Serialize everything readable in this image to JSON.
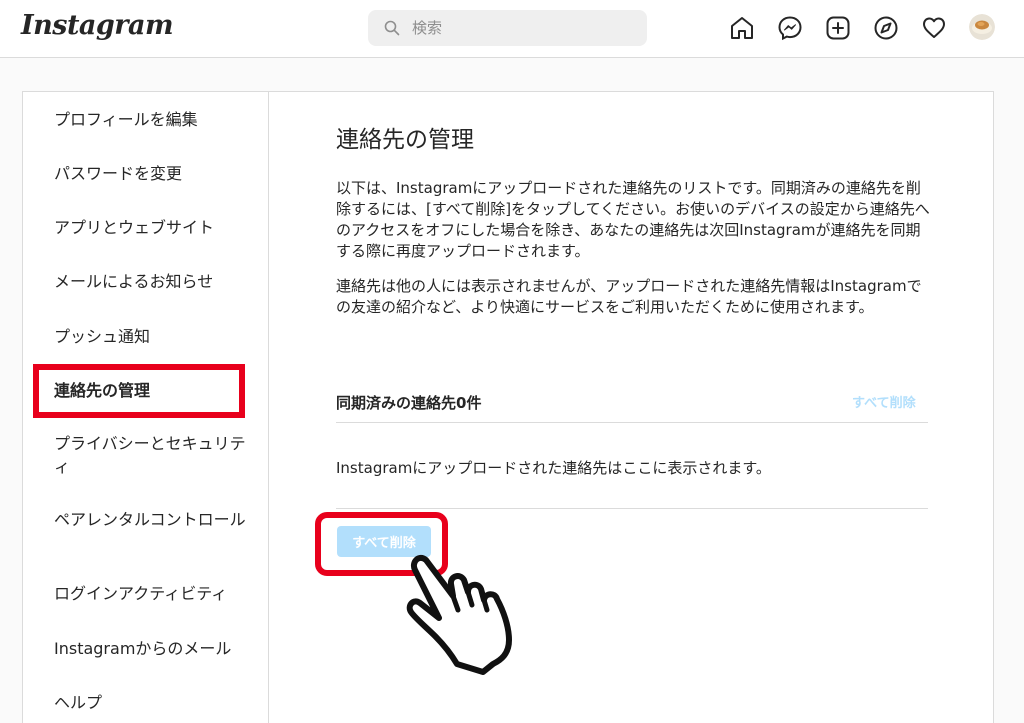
{
  "header": {
    "logo": "Instagram",
    "search_placeholder": "検索",
    "icons": [
      "home-icon",
      "messenger-icon",
      "new-post-icon",
      "explore-icon",
      "activity-heart-icon",
      "avatar"
    ]
  },
  "sidebar": {
    "items": [
      {
        "label": "プロフィールを編集"
      },
      {
        "label": "パスワードを変更"
      },
      {
        "label": "アプリとウェブサイト"
      },
      {
        "label": "メールによるお知らせ"
      },
      {
        "label": "プッシュ通知"
      },
      {
        "label": "連絡先の管理",
        "active": true
      },
      {
        "label": "プライバシーとセキュリティ"
      },
      {
        "label": "ペアレンタルコントロール"
      },
      {
        "label": "ログインアクティビティ"
      },
      {
        "label": "Instagramからのメール"
      },
      {
        "label": "ヘルプ"
      }
    ]
  },
  "main": {
    "title": "連絡先の管理",
    "paragraph1": "以下は、Instagramにアップロードされた連絡先のリストです。同期済みの連絡先を削除するには、[すべて削除]をタップしてください。お使いのデバイスの設定から連絡先へのアクセスをオフにした場合を除き、あなたの連絡先は次回Instagramが連絡先を同期する際に再度アップロードされます。",
    "paragraph2": "連絡先は他の人には表示されませんが、アップロードされた連絡先情報はInstagramでの友達の紹介など、より快適にサービスをご利用いただくために使用されます。",
    "synced_heading": "同期済みの連絡先0件",
    "delete_all_link": "すべて削除",
    "empty_message": "Instagramにアップロードされた連絡先はここに表示されます。",
    "delete_all_button": "すべて削除"
  },
  "colors": {
    "highlight": "#e8001c",
    "disabled_blue": "#b2dffc",
    "border": "#dbdbdb"
  }
}
